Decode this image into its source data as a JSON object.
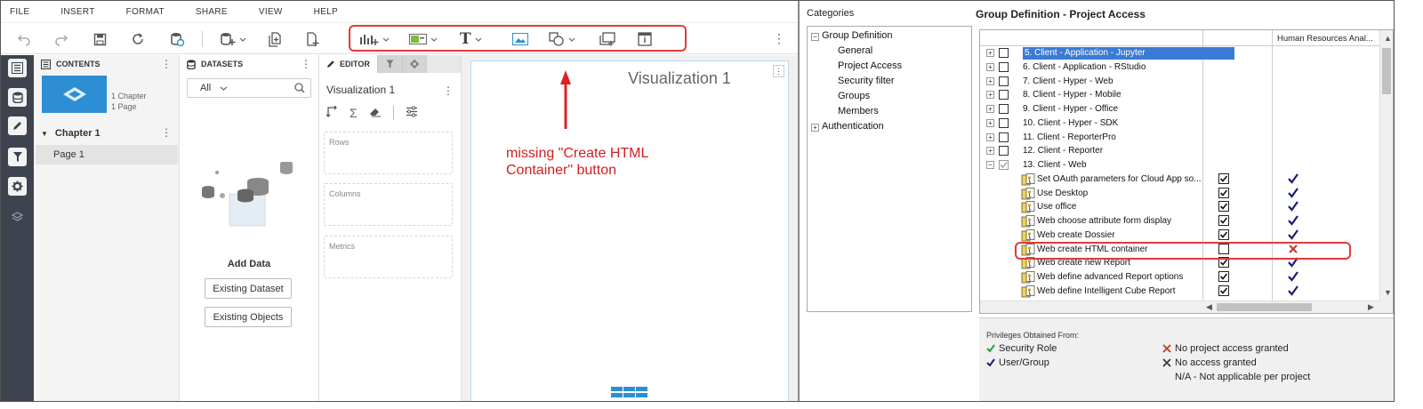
{
  "menu": [
    "FILE",
    "INSERT",
    "FORMAT",
    "SHARE",
    "VIEW",
    "HELP"
  ],
  "toolbar_icons": [
    "undo-icon",
    "redo-icon",
    "save-icon",
    "refresh-icon",
    "data-settings-icon",
    "add-data-icon",
    "new-page-icon",
    "add-chapter-icon",
    "visualization-icon",
    "filter-icon",
    "text-icon",
    "image-icon",
    "shapes-icon",
    "panel-stack-icon",
    "info-window-icon"
  ],
  "contents": {
    "header": "CONTENTS",
    "thumb_meta": [
      "1 Chapter",
      "1 Page"
    ],
    "chapter": "Chapter 1",
    "page": "Page 1"
  },
  "datasets": {
    "header": "DATASETS",
    "filter_value": "All",
    "add_data": "Add Data",
    "existing_dataset": "Existing Dataset",
    "existing_objects": "Existing Objects"
  },
  "editor": {
    "tab": "EDITOR",
    "viz_name": "Visualization 1",
    "zones": [
      "Rows",
      "Columns",
      "Metrics"
    ]
  },
  "canvas": {
    "viz_title": "Visualization 1",
    "annotation": [
      "missing \"Create HTML",
      "Container\" button"
    ],
    "more_label": "⋮"
  },
  "dialog": {
    "categories_label": "Categories",
    "tree": {
      "group_definition": "Group Definition",
      "children": [
        "General",
        "Project Access",
        "Security filter",
        "Groups",
        "Members"
      ],
      "authentication": "Authentication"
    },
    "title": "Group Definition - Project Access",
    "column_header": "Human Resources Anal...",
    "roots": [
      "5. Client - Application - Jupyter",
      "6. Client - Application - RStudio",
      "7. Client - Hyper - Web",
      "8. Client - Hyper - Mobile",
      "9. Client - Hyper - Office",
      "10. Client - Hyper - SDK",
      "11. Client - ReporterPro",
      "12. Client - Reporter",
      "13. Client - Web"
    ],
    "privileges": [
      {
        "label": "Set OAuth parameters for Cloud App so...",
        "checked": true,
        "status": "granted"
      },
      {
        "label": "Use Desktop",
        "checked": true,
        "status": "granted"
      },
      {
        "label": "Use office",
        "checked": true,
        "status": "granted"
      },
      {
        "label": "Web choose attribute form display",
        "checked": true,
        "status": "granted"
      },
      {
        "label": "Web create Dossier",
        "checked": true,
        "status": "granted"
      },
      {
        "label": "Web create HTML container",
        "checked": false,
        "status": "denied"
      },
      {
        "label": "Web create new Report",
        "checked": true,
        "status": "granted"
      },
      {
        "label": "Web define advanced Report options",
        "checked": true,
        "status": "granted"
      },
      {
        "label": "Web define Intelligent Cube Report",
        "checked": true,
        "status": "granted"
      }
    ],
    "legend": {
      "title": "Privileges Obtained From:",
      "security_role": "Security Role",
      "user_group": "User/Group",
      "no_project_access": "No project access granted",
      "no_access": "No access granted",
      "na": "N/A - Not applicable per project"
    },
    "colors": {
      "selection": "#3a7bd5",
      "annotation": "#e23a3a",
      "granted": "#1a1a7a",
      "denied": "#c0392b",
      "security_role": "#2e9b3e"
    }
  }
}
